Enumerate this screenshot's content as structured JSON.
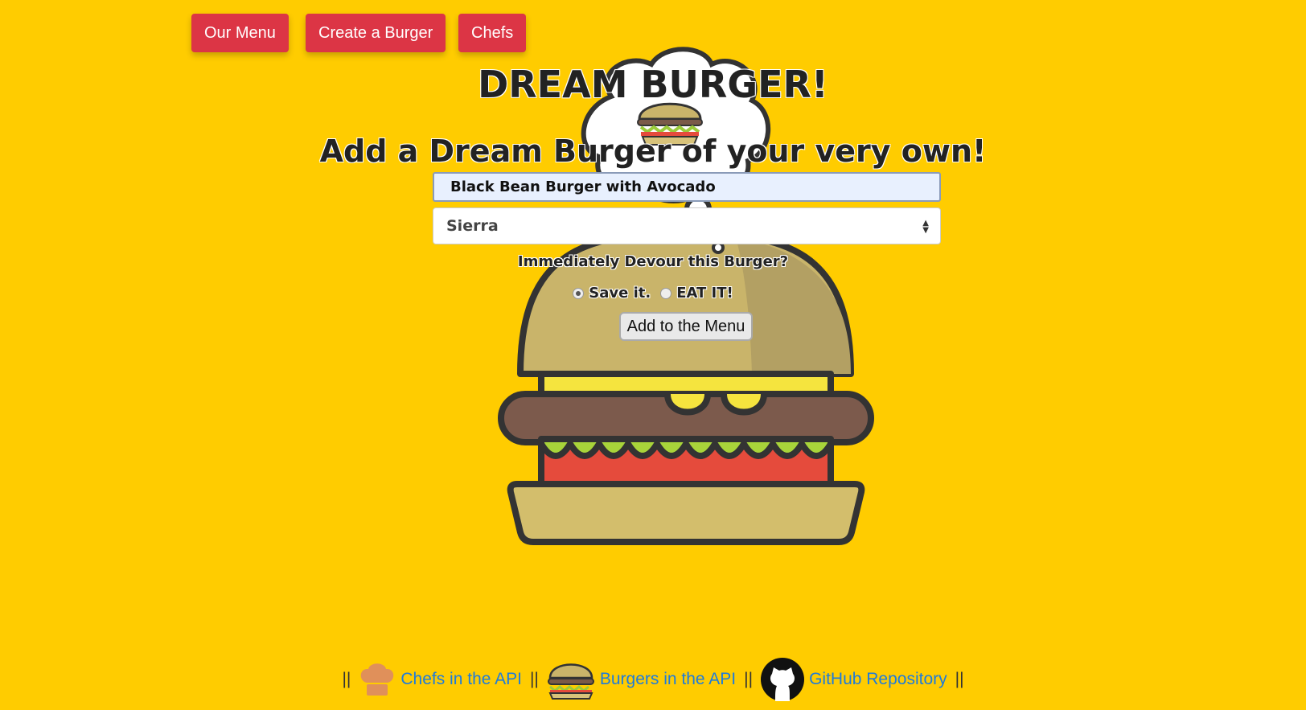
{
  "nav": {
    "our_menu": "Our Menu",
    "create_burger": "Create a Burger",
    "chefs": "Chefs"
  },
  "header": {
    "title": "DREAM BURGER!",
    "subtitle": "Add a Dream Burger of your very own!"
  },
  "form": {
    "burger_name_value": "Black Bean Burger with Avocado",
    "chef_selected": "Sierra",
    "devour_question": "Immediately Devour this Burger?",
    "option_save": "Save it.",
    "option_eat": "EAT IT!",
    "selected_option": "Save it.",
    "submit_label": "Add to the Menu"
  },
  "footer": {
    "separator": "||",
    "chefs_api_label": "Chefs in the API",
    "burgers_api_label": "Burgers in the API",
    "github_label": "GitHub Repository"
  },
  "colors": {
    "background": "#FFCC00",
    "nav_button": "#DC3545",
    "link": "#1E7BDB"
  }
}
